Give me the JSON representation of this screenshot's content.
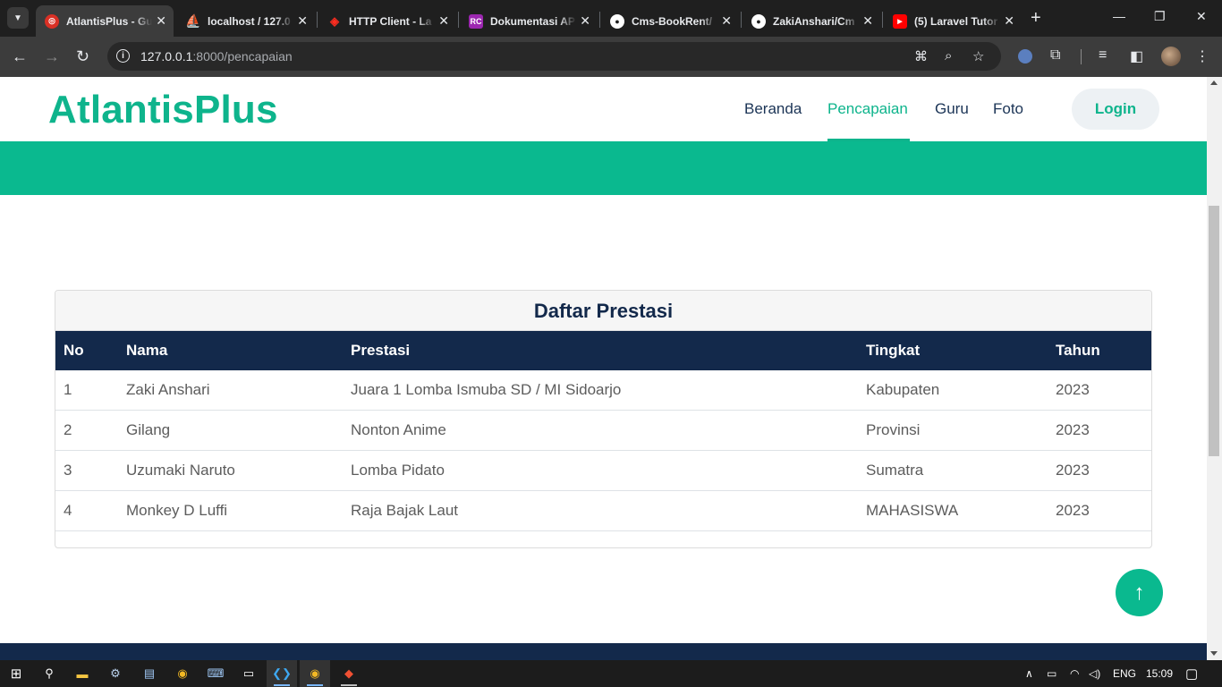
{
  "browser": {
    "tabs": [
      {
        "title": "AtlantisPlus - Gu",
        "favicon": "target-icon",
        "fav_color": "#d93025",
        "active": true
      },
      {
        "title": "localhost / 127.0",
        "favicon": "phpmyadmin-icon",
        "fav_color": "#f29111",
        "active": false
      },
      {
        "title": "HTTP Client - La",
        "favicon": "laravel-icon",
        "fav_color": "#ff2d20",
        "active": false
      },
      {
        "title": "Dokumentasi AP",
        "favicon": "rc-icon",
        "fav_color": "#9c27b0",
        "active": false
      },
      {
        "title": "Cms-BookRent/",
        "favicon": "github-icon",
        "fav_color": "#ffffff",
        "active": false
      },
      {
        "title": "ZakiAnshari/Cm",
        "favicon": "github-icon",
        "fav_color": "#ffffff",
        "active": false
      },
      {
        "title": "(5) Laravel Tutor",
        "favicon": "youtube-icon",
        "fav_color": "#ff0000",
        "active": false
      }
    ],
    "url_host": "127.0.0.1",
    "url_path": ":8000/pencapaian"
  },
  "site": {
    "logo": "AtlantisPlus",
    "nav": [
      {
        "label": "Beranda",
        "active": false
      },
      {
        "label": "Pencapaian",
        "active": true
      },
      {
        "label": "Guru",
        "active": false
      },
      {
        "label": "Foto",
        "active": false
      }
    ],
    "login_label": "Login",
    "brand_color": "#0eb48c",
    "navy_color": "#13294b"
  },
  "prestasi": {
    "title": "Daftar Prestasi",
    "columns": [
      "No",
      "Nama",
      "Prestasi",
      "Tingkat",
      "Tahun"
    ],
    "rows": [
      [
        "1",
        "Zaki Anshari",
        "Juara 1 Lomba Ismuba SD / MI Sidoarjo",
        "Kabupaten",
        "2023"
      ],
      [
        "2",
        "Gilang",
        "Nonton Anime",
        "Provinsi",
        "2023"
      ],
      [
        "3",
        "Uzumaki Naruto",
        "Lomba Pidato",
        "Sumatra",
        "2023"
      ],
      [
        "4",
        "Monkey D Luffi",
        "Raja Bajak Laut",
        "MAHASISWA",
        "2023"
      ]
    ]
  },
  "taskbar": {
    "language": "ENG",
    "time": "15:09"
  }
}
